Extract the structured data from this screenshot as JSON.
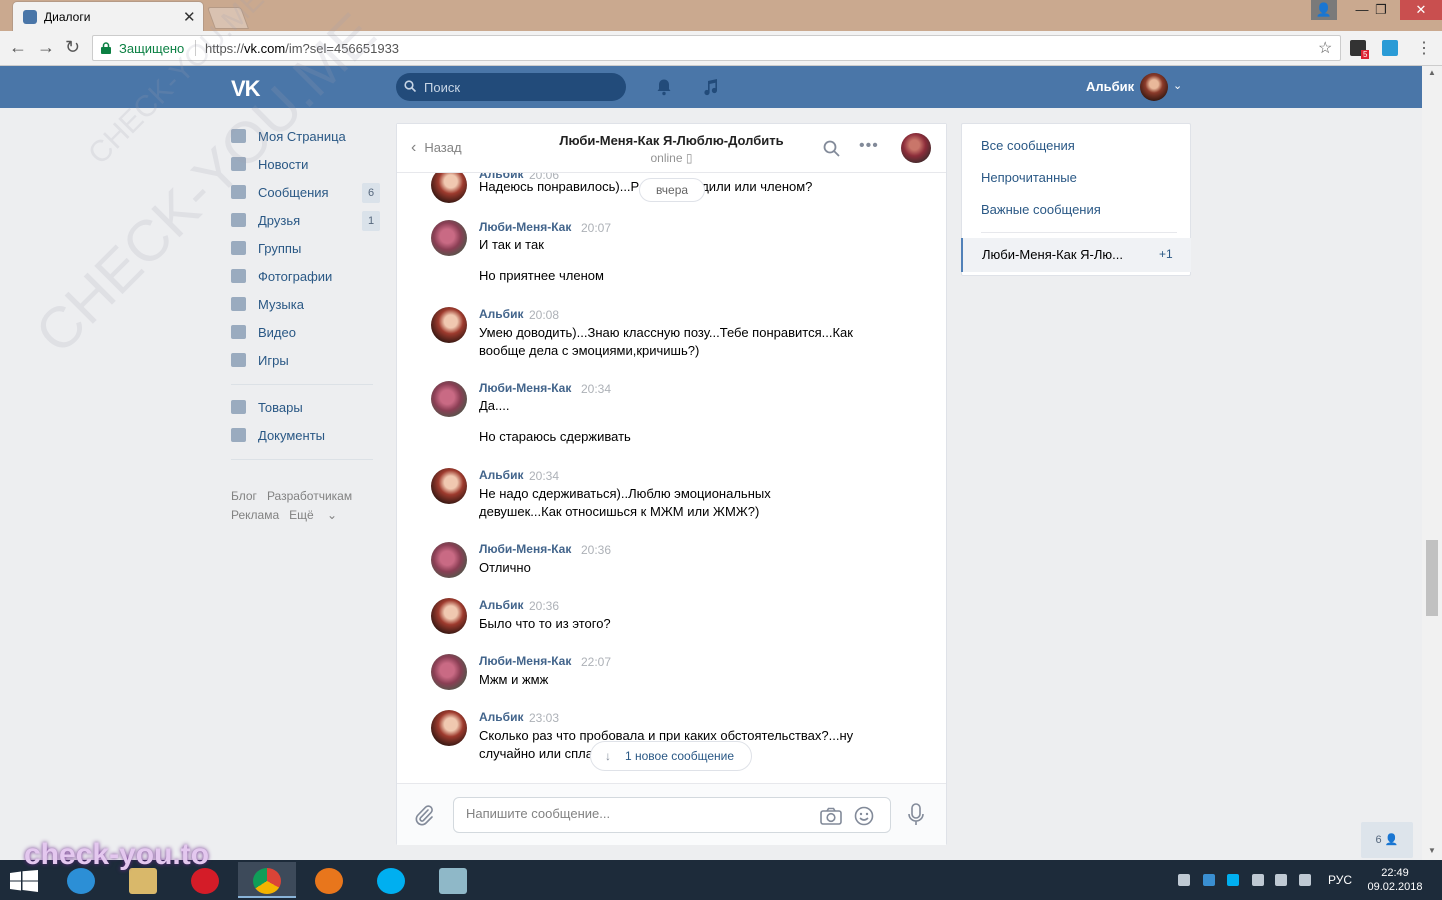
{
  "browser": {
    "tab_title": "Диалоги",
    "security_label": "Защищено",
    "url_prefix": "https://",
    "url_host": "vk.com",
    "url_path": "/im?sel=456651933",
    "ext_badge": "5"
  },
  "header": {
    "logo": "VK",
    "search_placeholder": "Поиск",
    "user_name": "Альбик"
  },
  "sidebar": {
    "items": [
      {
        "label": "Моя Страница",
        "icon": "home-icon"
      },
      {
        "label": "Новости",
        "icon": "news-icon"
      },
      {
        "label": "Сообщения",
        "icon": "messages-icon",
        "badge": "6"
      },
      {
        "label": "Друзья",
        "icon": "friends-icon",
        "badge": "1"
      },
      {
        "label": "Группы",
        "icon": "groups-icon"
      },
      {
        "label": "Фотографии",
        "icon": "photos-icon"
      },
      {
        "label": "Музыка",
        "icon": "music-icon"
      },
      {
        "label": "Видео",
        "icon": "video-icon"
      },
      {
        "label": "Игры",
        "icon": "games-icon"
      }
    ],
    "items2": [
      {
        "label": "Товары",
        "icon": "goods-icon"
      },
      {
        "label": "Документы",
        "icon": "documents-icon"
      }
    ],
    "footer": [
      "Блог",
      "Разработчикам",
      "Реклама",
      "Ещё"
    ]
  },
  "conversation": {
    "back_label": "Назад",
    "title": "Люби-Меня-Как Я-Люблю-Долбить",
    "status": "online",
    "date_divider": "вчера",
    "new_message_label": "1 новое сообщение",
    "input_placeholder": "Напишите сообщение...",
    "messages": [
      {
        "author": "Альбик",
        "time": "20:06",
        "text": "Надеюсь понравилось)...Р",
        "text_tail": "дили или членом?"
      },
      {
        "author": "Люби-Меня-Как",
        "time": "20:07",
        "text": "И так и так\n\nНо приятнее членом"
      },
      {
        "author": "Альбик",
        "time": "20:08",
        "text": "Умею доводить)...Знаю классную позу...Тебе понравится...Как\nвообще дела с эмоциями,кричишь?)"
      },
      {
        "author": "Люби-Меня-Как",
        "time": "20:34",
        "text": "Да....\n\nНо стараюсь сдерживать"
      },
      {
        "author": "Альбик",
        "time": "20:34",
        "text": "Не надо сдерживаться)..Люблю эмоциональных\nдевушек...Как относишься к МЖМ или ЖМЖ?)"
      },
      {
        "author": "Люби-Меня-Как",
        "time": "20:36",
        "text": "Отлично"
      },
      {
        "author": "Альбик",
        "time": "20:36",
        "text": "Было что то из этого?"
      },
      {
        "author": "Люби-Меня-Как",
        "time": "22:07",
        "text": "Мжм и жмж"
      },
      {
        "author": "Альбик",
        "time": "23:03",
        "text": "Сколько раз что пробовала и при каких обстоятельствах?...ну\nслучайно или спла"
      }
    ]
  },
  "right_panel": {
    "links": [
      "Все сообщения",
      "Непрочитанные",
      "Важные сообщения"
    ],
    "active_dialog": "Люби-Меня-Как Я-Лю...",
    "active_count": "+1"
  },
  "chat_counter": "6",
  "taskbar": {
    "lang": "РУС",
    "time": "22:49",
    "date": "09.02.2018"
  },
  "watermarks": {
    "diag": "CHECK-YOU.ME",
    "bottom": "check-you.to"
  },
  "colors": {
    "vk_blue": "#4a76a8",
    "link": "#2a5885",
    "author": "#42648b",
    "background": "#edeef0"
  }
}
